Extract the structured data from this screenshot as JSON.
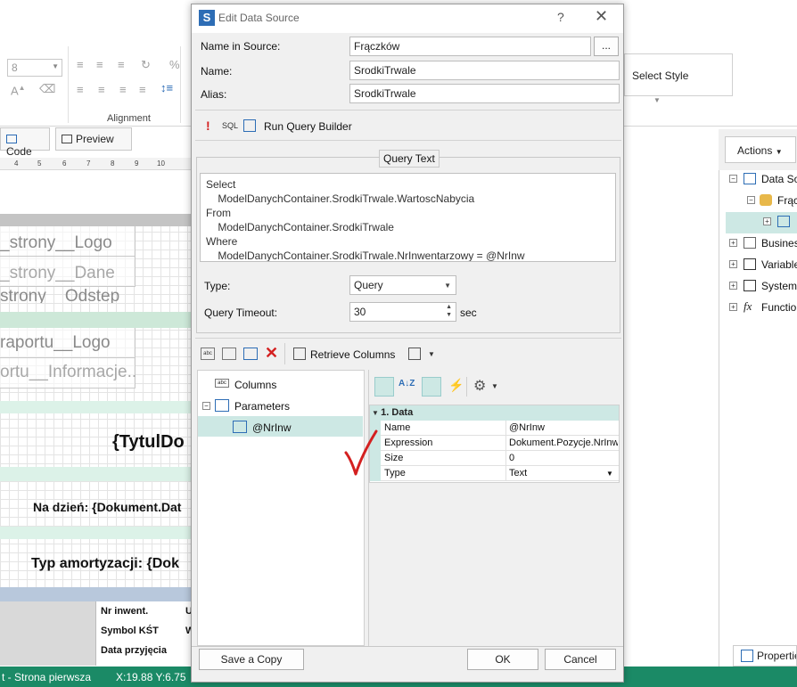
{
  "app": {
    "font_size": "8",
    "alignment_group": "Alignment",
    "select_style": "Select Style",
    "code_tab": "Code",
    "preview_tab": "Preview",
    "ruler_marks": [
      "4",
      "5",
      "6",
      "7",
      "8",
      "9",
      "10"
    ],
    "bands": {
      "strony_logo": "_strony__Logo",
      "strony_dane": "_strony__Dane",
      "strony_odstep": "strony__Odstep",
      "raportu_logo": "raportu__Logo",
      "raportu_informacje": "ortu__Informacje...",
      "tytul": "{TytulDo",
      "na_dzien": "Na dzień: {Dokument.Dat",
      "typ_amortyzacji": "Typ amortyzacji: {Dok"
    },
    "table_headers": [
      "Nr inwent.",
      "Symbol KŚT",
      "Data przyjęcia"
    ],
    "table_letters": [
      "U",
      "W"
    ],
    "status_page": "t - Strona pierwsza",
    "status_coords": "X:19.88  Y:6.75"
  },
  "right_panel": {
    "actions": "Actions",
    "tree": [
      "Data Sources",
      "Frączków",
      "",
      "Business Objects",
      "Variables",
      "System Variables",
      "Functions"
    ],
    "properties_tab": "Properties"
  },
  "dialog": {
    "title": "Edit Data Source",
    "help": "?",
    "close": "✕",
    "name_in_source_label": "Name in Source:",
    "name_in_source_value": "Frączków",
    "browse_button": "...",
    "name_label": "Name:",
    "name_value": "SrodkiTrwale",
    "alias_label": "Alias:",
    "alias_value": "SrodkiTrwale",
    "sql_label": "SQL",
    "run_query_builder": "Run Query Builder",
    "query_text_label": "Query Text",
    "query_text": "Select\n    ModelDanychContainer.SrodkiTrwale.WartoscNabycia\nFrom\n    ModelDanychContainer.SrodkiTrwale\nWhere\n    ModelDanychContainer.SrodkiTrwale.NrInwentarzowy = @NrInw",
    "type_label": "Type:",
    "type_value": "Query",
    "timeout_label": "Query Timeout:",
    "timeout_value": "30",
    "timeout_unit": "sec",
    "retrieve_columns": "Retrieve Columns",
    "tree_columns": "Columns",
    "tree_parameters": "Parameters",
    "tree_param_item": "@NrInw",
    "prop_category": "1. Data",
    "properties": [
      {
        "name": "Name",
        "value": "@NrInw"
      },
      {
        "name": "Expression",
        "value": "Dokument.Pozycje.NrInw"
      },
      {
        "name": "Size",
        "value": "0"
      },
      {
        "name": "Type",
        "value": "Text"
      }
    ],
    "save_copy": "Save a Copy",
    "ok": "OK",
    "cancel": "Cancel"
  },
  "colors": {
    "status_bar": "#1b8a66",
    "accent_blue": "#2d6db5",
    "selection": "#cde8e4",
    "check_mark": "#d42020"
  }
}
